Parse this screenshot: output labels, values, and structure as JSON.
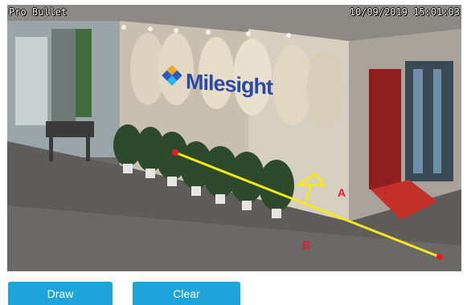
{
  "video": {
    "camera_name": "Pro Bullet",
    "timestamp": "10/09/2019 15:01:03",
    "logo_text": "Milesight",
    "region_a_label": "A",
    "region_b_label": "B"
  },
  "toolbar": {
    "draw_label": "Draw",
    "clear_label": "Clear"
  },
  "colors": {
    "button": "#1fa3db",
    "line": "#f5e81a",
    "endpoint": "#e8192a",
    "region_label": "#e8192a"
  },
  "icons": [
    "direction-arrow-icon",
    "milesight-logo-icon"
  ]
}
